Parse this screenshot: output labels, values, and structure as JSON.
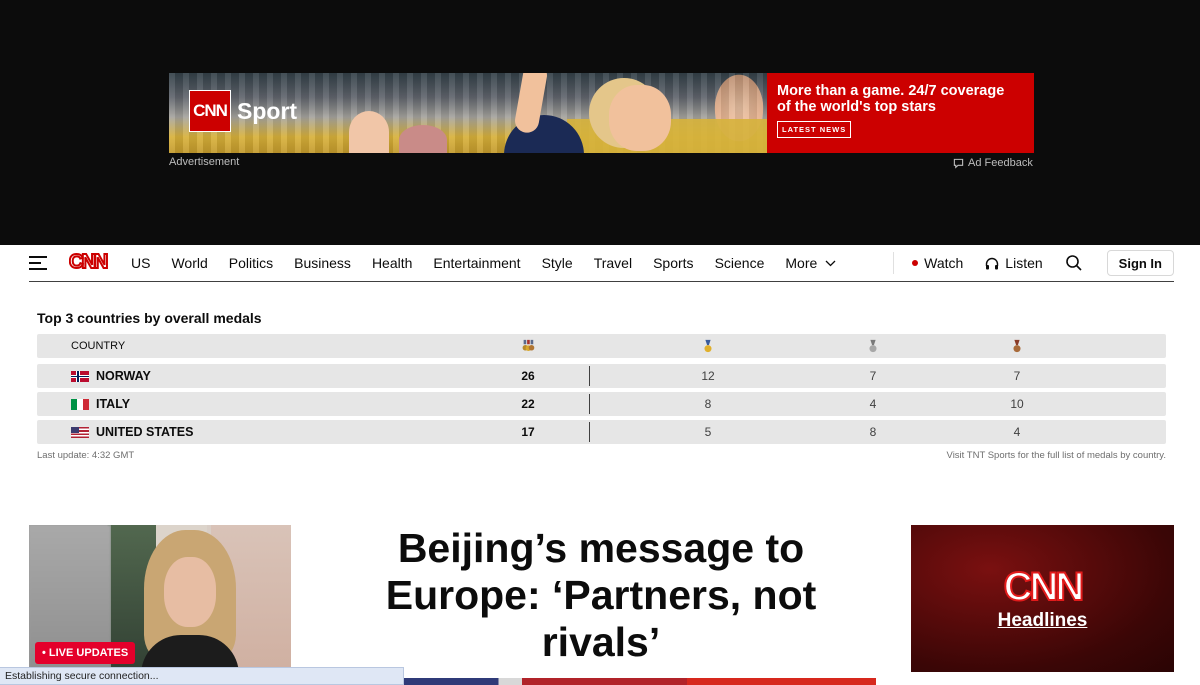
{
  "ad": {
    "brand_logo": "CNN",
    "brand_section": "Sport",
    "headline_line1": "More than a game. 24/7 coverage",
    "headline_line2": "of the world's top stars",
    "cta": "LATEST NEWS",
    "label": "Advertisement",
    "feedback": "Ad Feedback"
  },
  "nav": {
    "logo": "CNN",
    "links": [
      "US",
      "World",
      "Politics",
      "Business",
      "Health",
      "Entertainment",
      "Style",
      "Travel",
      "Sports",
      "Science"
    ],
    "more": "More",
    "watch": "Watch",
    "listen": "Listen",
    "sign_in": "Sign In",
    "accent_color": "#cc0000"
  },
  "medals": {
    "title": "Top 3 countries by overall medals",
    "header_country": "COUNTRY",
    "rows": [
      {
        "country": "NORWAY",
        "flag": "norway-flag",
        "total": "26",
        "gold": "12",
        "silver": "7",
        "bronze": "7"
      },
      {
        "country": "ITALY",
        "flag": "italy-flag",
        "total": "22",
        "gold": "8",
        "silver": "4",
        "bronze": "10"
      },
      {
        "country": "UNITED STATES",
        "flag": "usa-flag",
        "total": "17",
        "gold": "5",
        "silver": "8",
        "bronze": "4"
      }
    ],
    "last_update": "Last update: 4:32 GMT",
    "source_note": "Visit TNT Sports for the full list of medals by country."
  },
  "live": {
    "badge": "• LIVE UPDATES"
  },
  "headline": {
    "text": "Beijing’s message to Europe: ‘Partners, not rivals’"
  },
  "headlines_promo": {
    "logo": "CNN",
    "label": "Headlines"
  },
  "status_bar": {
    "text": "Establishing secure connection..."
  }
}
